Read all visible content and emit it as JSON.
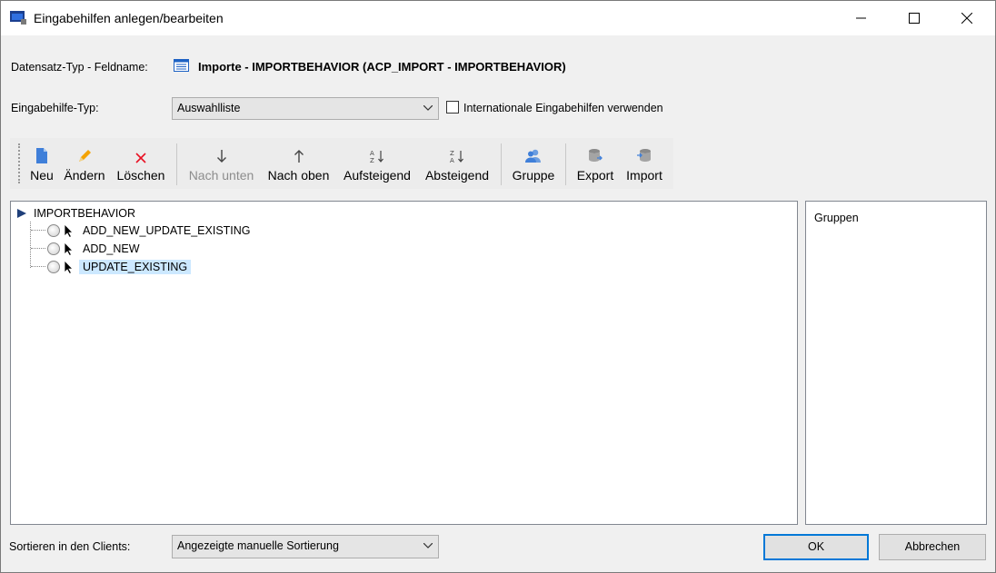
{
  "window": {
    "title": "Eingabehilfen anlegen/bearbeiten"
  },
  "record": {
    "label": "Datensatz-Typ - Feldname:",
    "value": "Importe - IMPORTBEHAVIOR (ACP_IMPORT - IMPORTBEHAVIOR)"
  },
  "input_help_type": {
    "label": "Eingabehilfe-Typ:",
    "selected": "Auswahlliste"
  },
  "international": {
    "label": "Internationale Eingabehilfen verwenden",
    "checked": false
  },
  "toolbar": {
    "new": "Neu",
    "edit": "Ändern",
    "delete": "Löschen",
    "move_down": "Nach unten",
    "move_up": "Nach oben",
    "ascending": "Aufsteigend",
    "descending": "Absteigend",
    "group": "Gruppe",
    "export": "Export",
    "import": "Import"
  },
  "tree": {
    "root": "IMPORTBEHAVIOR",
    "items": [
      {
        "label": "ADD_NEW_UPDATE_EXISTING",
        "selected": false
      },
      {
        "label": "ADD_NEW",
        "selected": false
      },
      {
        "label": "UPDATE_EXISTING",
        "selected": true
      }
    ]
  },
  "groups": {
    "label": "Gruppen"
  },
  "sort": {
    "label": "Sortieren in den Clients:",
    "selected": "Angezeigte manuelle Sortierung"
  },
  "buttons": {
    "ok": "OK",
    "cancel": "Abbrechen"
  },
  "colors": {
    "accent": "#0078d7",
    "selection": "#cce8ff",
    "delete_icon": "#e81123",
    "edit_icon": "#f4a300"
  }
}
